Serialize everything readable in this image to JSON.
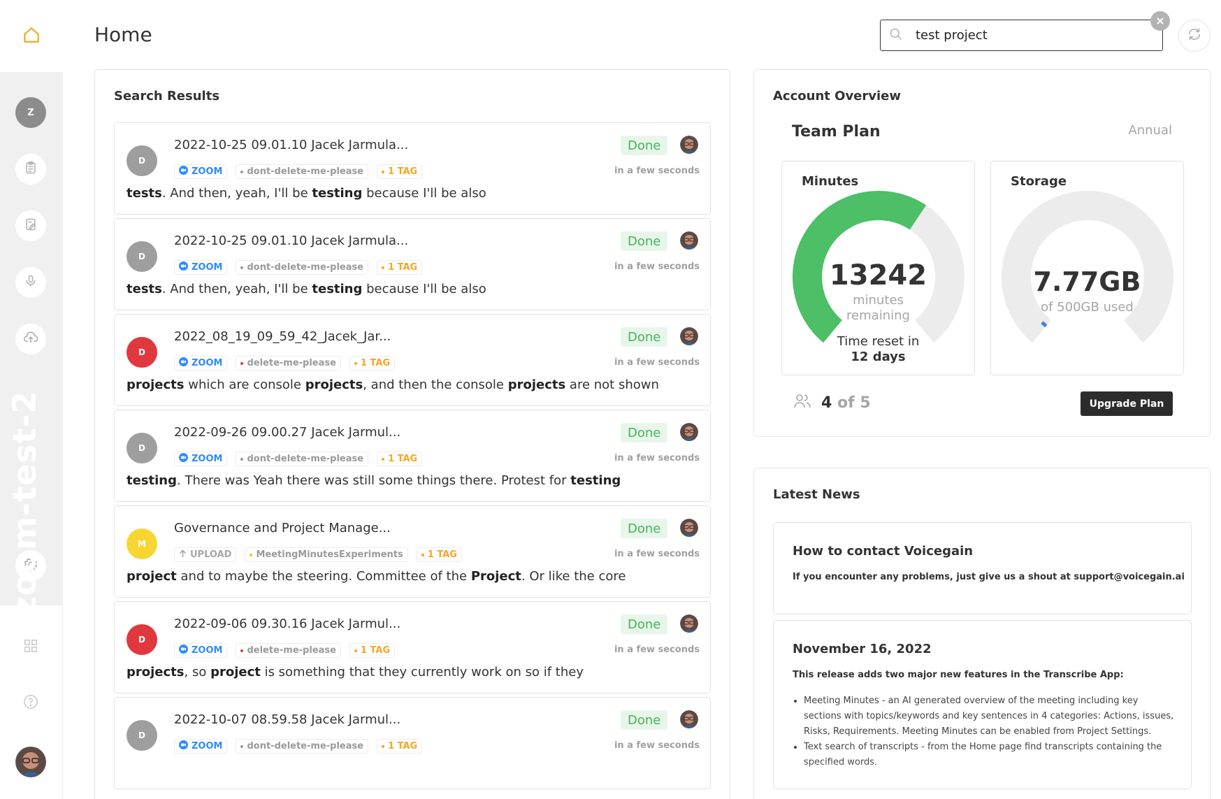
{
  "header": {
    "title": "Home"
  },
  "search": {
    "value": "test project",
    "placeholder": ""
  },
  "sidebar": {
    "workspace_initial": "Z",
    "workspace_name": "zoom-test-2"
  },
  "results": {
    "title": "Search Results",
    "items": [
      {
        "avatar_initial": "D",
        "avatar_color": "#9e9e9e",
        "title": "2022-10-25 09.01.10 Jacek Jarmula...",
        "source": "ZOOM",
        "source_icon": "zoom-icon",
        "folder": "dont-delete-me-please",
        "folder_dot_color": "#9a9a9a",
        "tag_count": "1 TAG",
        "status": "Done",
        "time": "in a few seconds",
        "snippet": [
          {
            "t": "tests",
            "b": true
          },
          {
            "t": ". And then, yeah, I'll be ",
            "b": false
          },
          {
            "t": "testing",
            "b": true
          },
          {
            "t": " because I'll be also",
            "b": false
          }
        ]
      },
      {
        "avatar_initial": "D",
        "avatar_color": "#9e9e9e",
        "title": "2022-10-25 09.01.10 Jacek Jarmula...",
        "source": "ZOOM",
        "source_icon": "zoom-icon",
        "folder": "dont-delete-me-please",
        "folder_dot_color": "#9a9a9a",
        "tag_count": "1 TAG",
        "status": "Done",
        "time": "in a few seconds",
        "snippet": [
          {
            "t": "tests",
            "b": true
          },
          {
            "t": ". And then, yeah, I'll be ",
            "b": false
          },
          {
            "t": "testing",
            "b": true
          },
          {
            "t": " because I'll be also",
            "b": false
          }
        ]
      },
      {
        "avatar_initial": "D",
        "avatar_color": "#e0383e",
        "title": "2022_08_19_09_59_42_Jacek_Jar...",
        "source": "ZOOM",
        "source_icon": "zoom-icon",
        "folder": "delete-me-please",
        "folder_dot_color": "#e0383e",
        "tag_count": "1 TAG",
        "status": "Done",
        "time": "in a few seconds",
        "snippet": [
          {
            "t": "projects",
            "b": true
          },
          {
            "t": " which are console ",
            "b": false
          },
          {
            "t": "projects",
            "b": true
          },
          {
            "t": ", and then the console ",
            "b": false
          },
          {
            "t": "projects",
            "b": true
          },
          {
            "t": " are not shown",
            "b": false
          }
        ]
      },
      {
        "avatar_initial": "D",
        "avatar_color": "#9e9e9e",
        "title": "2022-09-26 09.00.27 Jacek Jarmul...",
        "source": "ZOOM",
        "source_icon": "zoom-icon",
        "folder": "dont-delete-me-please",
        "folder_dot_color": "#9a9a9a",
        "tag_count": "1 TAG",
        "status": "Done",
        "time": "in a few seconds",
        "snippet": [
          {
            "t": "testing",
            "b": true
          },
          {
            "t": ". There was Yeah there was still some things there. Protest for ",
            "b": false
          },
          {
            "t": "testing",
            "b": true
          }
        ]
      },
      {
        "avatar_initial": "M",
        "avatar_color": "#f7d633",
        "title": "Governance and Project Manage...",
        "source": "UPLOAD",
        "source_icon": "upload-arrow-icon",
        "folder": "MeetingMinutesExperiments",
        "folder_dot_color": "#f5c518",
        "tag_count": "1 TAG",
        "status": "Done",
        "time": "in a few seconds",
        "snippet": [
          {
            "t": "project",
            "b": true
          },
          {
            "t": " and to maybe the steering. Committee of the ",
            "b": false
          },
          {
            "t": "Project",
            "b": true
          },
          {
            "t": ". Or like the core",
            "b": false
          }
        ]
      },
      {
        "avatar_initial": "D",
        "avatar_color": "#e0383e",
        "title": "2022-09-06 09.30.16 Jacek Jarmul...",
        "source": "ZOOM",
        "source_icon": "zoom-icon",
        "folder": "delete-me-please",
        "folder_dot_color": "#e0383e",
        "tag_count": "1 TAG",
        "status": "Done",
        "time": "in a few seconds",
        "snippet": [
          {
            "t": "projects",
            "b": true
          },
          {
            "t": ", so ",
            "b": false
          },
          {
            "t": "project",
            "b": true
          },
          {
            "t": " is something that they currently work on so if they",
            "b": false
          }
        ]
      },
      {
        "avatar_initial": "D",
        "avatar_color": "#9e9e9e",
        "title": "2022-10-07 08.59.58 Jacek Jarmul...",
        "source": "ZOOM",
        "source_icon": "zoom-icon",
        "folder": "dont-delete-me-please",
        "folder_dot_color": "#9a9a9a",
        "tag_count": "1 TAG",
        "status": "Done",
        "time": "in a few seconds",
        "snippet": []
      }
    ]
  },
  "account": {
    "title": "Account Overview",
    "plan_name": "Team Plan",
    "plan_period": "Annual",
    "minutes": {
      "title": "Minutes",
      "remaining": "13242",
      "remaining_label_1": "minutes",
      "remaining_label_2": "remaining",
      "reset_label": "Time reset in",
      "reset_days": "12 days",
      "used_fraction": 0.62,
      "color": "#4cbf67"
    },
    "storage": {
      "title": "Storage",
      "used": "7.77GB",
      "of_label": "of 500GB used",
      "used_fraction": 0.016,
      "color": "#4a7fe0"
    },
    "users": {
      "current": "4",
      "of_text": "of 5"
    },
    "upgrade_label": "Upgrade Plan"
  },
  "news": {
    "title": "Latest News",
    "items": [
      {
        "heading": "How to contact Voicegain",
        "text": "If you encounter any problems, just give us a shout at support@voicegain.ai"
      },
      {
        "heading": "November 16, 2022",
        "text": "This release adds two major new features in the Transcribe App:",
        "bullets": [
          "Meeting Minutes - an AI generated overview of the meeting including key sections with topics/keywords and key sentences in 4 categories: Actions, issues, Risks, Requirements. Meeting Minutes can be enabled from Project Settings.",
          "Text search of transcripts - from the Home page find transcripts containing the specified words."
        ]
      }
    ]
  },
  "colors": {
    "accent": "#f5a623",
    "done_bg": "#e8f6ea",
    "done_text": "#46b35a",
    "zoom_blue": "#2d8cff"
  }
}
